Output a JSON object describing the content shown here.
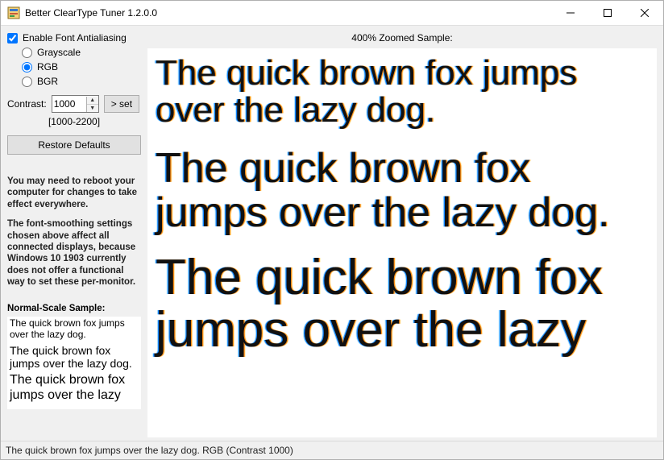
{
  "window": {
    "title": "Better ClearType Tuner 1.2.0.0"
  },
  "header": {
    "zoom_label": "400% Zoomed Sample:"
  },
  "settings": {
    "antialias_label": "Enable Font Antialiasing",
    "antialias_checked": true,
    "modes": {
      "grayscale": "Grayscale",
      "rgb": "RGB",
      "bgr": "BGR",
      "selected": "rgb"
    },
    "contrast_label": "Contrast:",
    "contrast_value": "1000",
    "contrast_range": "[1000-2200]",
    "set_button": "> set",
    "restore_button": "Restore Defaults"
  },
  "info": {
    "p1": "You may need to reboot your computer for changes to take effect everywhere.",
    "p2": "The font-smoothing settings chosen above affect all connected displays, because Windows 10 1903 currently does not offer a functional way to set these per-monitor."
  },
  "normal_sample": {
    "label": "Normal-Scale Sample:",
    "line1": "The quick brown fox jumps over the lazy dog.",
    "line2": "The quick brown fox jumps over the lazy dog.",
    "line3": "The quick brown fox jumps over the lazy"
  },
  "zoom_sample": {
    "line1": "The quick brown fox jumps over the lazy dog.",
    "line2": "The quick brown fox jumps over the lazy dog.",
    "line3": "The quick brown fox jumps over the lazy"
  },
  "statusbar": {
    "text": "The quick brown fox jumps over the lazy dog. RGB (Contrast 1000)"
  }
}
